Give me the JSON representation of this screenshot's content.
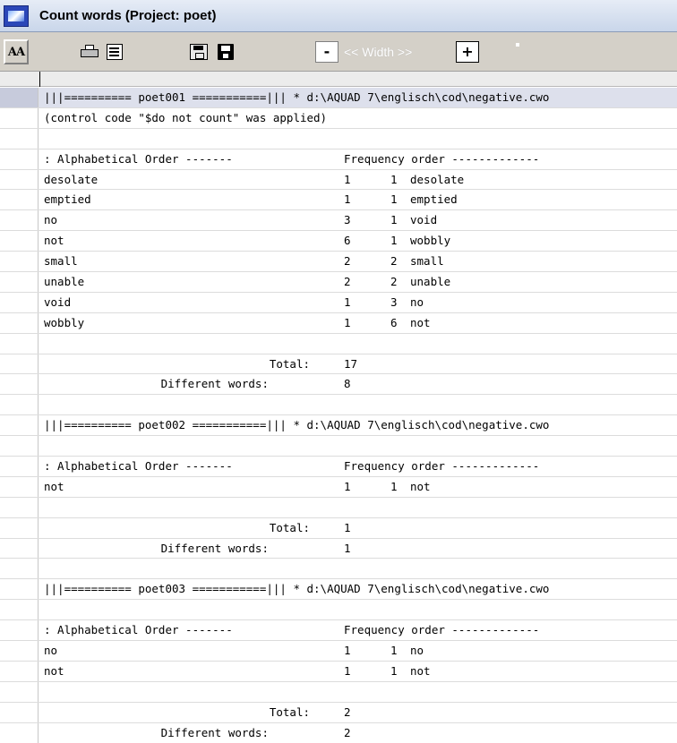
{
  "window": {
    "title": "Count words (Project: poet)"
  },
  "toolbar": {
    "font_button": "AA",
    "minus_button": "-",
    "width_label": "<< Width >>",
    "plus_button": "+"
  },
  "results": {
    "control_note": "(control code \"$do not count\" was applied)",
    "header_alpha": ": Alphabetical Order -------",
    "header_freq": "Frequency order -------------",
    "total_label": "Total:",
    "different_label": "Different words:",
    "sections": [
      {
        "banner": "|||========== poet001 ===========||| * d:\\AQUAD 7\\englisch\\cod\\negative.cwo",
        "rows": [
          {
            "word": "desolate",
            "count": "1",
            "freq": "1",
            "fword": "desolate"
          },
          {
            "word": "emptied",
            "count": "1",
            "freq": "1",
            "fword": "emptied"
          },
          {
            "word": "no",
            "count": "3",
            "freq": "1",
            "fword": "void"
          },
          {
            "word": "not",
            "count": "6",
            "freq": "1",
            "fword": "wobbly"
          },
          {
            "word": "small",
            "count": "2",
            "freq": "2",
            "fword": "small"
          },
          {
            "word": "unable",
            "count": "2",
            "freq": "2",
            "fword": "unable"
          },
          {
            "word": "void",
            "count": "1",
            "freq": "3",
            "fword": "no"
          },
          {
            "word": "wobbly",
            "count": "1",
            "freq": "6",
            "fword": "not"
          }
        ],
        "total": "17",
        "different": "8"
      },
      {
        "banner": "|||========== poet002 ===========||| * d:\\AQUAD 7\\englisch\\cod\\negative.cwo",
        "rows": [
          {
            "word": "not",
            "count": "1",
            "freq": "1",
            "fword": "not"
          }
        ],
        "total": "1",
        "different": "1"
      },
      {
        "banner": "|||========== poet003 ===========||| * d:\\AQUAD 7\\englisch\\cod\\negative.cwo",
        "rows": [
          {
            "word": "no",
            "count": "1",
            "freq": "1",
            "fword": "no"
          },
          {
            "word": "not",
            "count": "1",
            "freq": "1",
            "fword": "not"
          }
        ],
        "total": "2",
        "different": "2"
      }
    ]
  }
}
